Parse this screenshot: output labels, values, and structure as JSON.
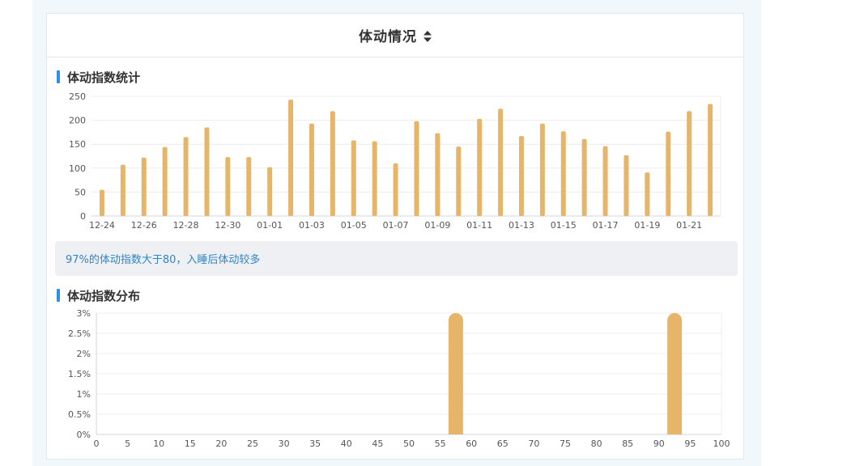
{
  "card": {
    "title": "体动情况"
  },
  "section1": {
    "title": "体动指数统计"
  },
  "section2": {
    "title": "体动指数分布"
  },
  "note": {
    "text": "97%的体动指数大于80，入睡后体动较多"
  },
  "colors": {
    "bar": "#e6b56a",
    "accent": "#2f8ff0",
    "note_text": "#2f86c4",
    "note_bg": "#eff0f4"
  },
  "icons": {
    "sort": "sort-icon"
  },
  "chart_data": [
    {
      "type": "bar",
      "title": "体动指数统计",
      "categories": [
        "12-24",
        "12-25",
        "12-26",
        "12-27",
        "12-28",
        "12-29",
        "12-30",
        "12-31",
        "01-01",
        "01-02",
        "01-03",
        "01-04",
        "01-05",
        "01-06",
        "01-07",
        "01-08",
        "01-09",
        "01-10",
        "01-11",
        "01-12",
        "01-13",
        "01-14",
        "01-15",
        "01-16",
        "01-17",
        "01-18",
        "01-19",
        "01-20",
        "01-21",
        "01-22"
      ],
      "tick_labels": [
        "12-24",
        "12-26",
        "12-28",
        "12-30",
        "01-01",
        "01-03",
        "01-05",
        "01-07",
        "01-09",
        "01-11",
        "01-13",
        "01-15",
        "01-17",
        "01-19",
        "01-21"
      ],
      "values": [
        55,
        107,
        122,
        144,
        165,
        185,
        123,
        123,
        102,
        243,
        193,
        219,
        158,
        156,
        110,
        198,
        173,
        145,
        203,
        224,
        167,
        193,
        177,
        161,
        146,
        127,
        91,
        176,
        219,
        234
      ],
      "ylim": [
        0,
        250
      ],
      "yticks": [
        0,
        50,
        100,
        150,
        200,
        250
      ],
      "grid": true
    },
    {
      "type": "bar",
      "title": "体动指数分布",
      "x": [
        57.5,
        92.5
      ],
      "values": [
        3,
        3
      ],
      "xlim": [
        0,
        100
      ],
      "xticks": [
        0,
        5,
        10,
        15,
        20,
        25,
        30,
        35,
        40,
        45,
        50,
        55,
        60,
        65,
        70,
        75,
        80,
        85,
        90,
        95,
        100
      ],
      "ylim": [
        0,
        3
      ],
      "yticks": [
        "0%",
        "0.5%",
        "1%",
        "1.5%",
        "2%",
        "2.5%",
        "3%"
      ],
      "grid": true
    }
  ]
}
